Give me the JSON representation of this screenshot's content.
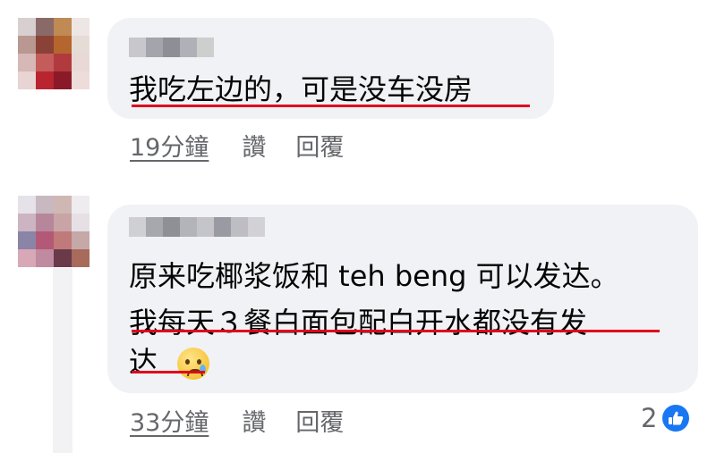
{
  "avatar_colors_1": [
    "#d8d0d0",
    "#8a6a68",
    "#c08a55",
    "#eee6e4",
    "#b89890",
    "#8a4236",
    "#b4662e",
    "#e6dcd6",
    "#d6b8b6",
    "#c45c5c",
    "#b13a3e",
    "#e8d8d6",
    "#e8d4d2",
    "#b92430",
    "#8a1a28",
    "#eedcda"
  ],
  "avatar_colors_2": [
    "#e6e2ea",
    "#c8b8c0",
    "#cfb8b4",
    "#eeecee",
    "#ccb4c2",
    "#b8869a",
    "#c8a4a6",
    "#e6e0e4",
    "#8a84a6",
    "#b45878",
    "#c07a7a",
    "#c6a8a8",
    "#d8a8b6",
    "#c08aa0",
    "#6a3a4a",
    "#a86a5a"
  ],
  "name_blur_1": [
    "#c8c8cc",
    "#a4a4ac",
    "#8e8e96",
    "#b0b0b8",
    "#cecece"
  ],
  "name_blur_2": [
    "#cfcfd4",
    "#a7a7ae",
    "#8f8f96",
    "#b3b3ba",
    "#c4c4c9",
    "#9a9aa2",
    "#bdbdc3",
    "#d2d2d6"
  ],
  "comments": [
    {
      "text": "我吃左边的，可是没车没房",
      "time": "19分鐘",
      "like_label": "讚",
      "reply_label": "回覆"
    },
    {
      "line1": "原来吃椰浆饭和 teh beng 可以发达。",
      "line2": "我每天３餐白面包配白开水都没有发",
      "line3": "达",
      "emoji": "crying-face",
      "time": "33分鐘",
      "like_label": "讚",
      "reply_label": "回覆",
      "reaction_count": "2"
    }
  ],
  "colors": {
    "bubble_bg": "#f0f2f5",
    "underline": "#e0001b",
    "action_text": "#65676b",
    "like_blue": "#1877f2"
  }
}
